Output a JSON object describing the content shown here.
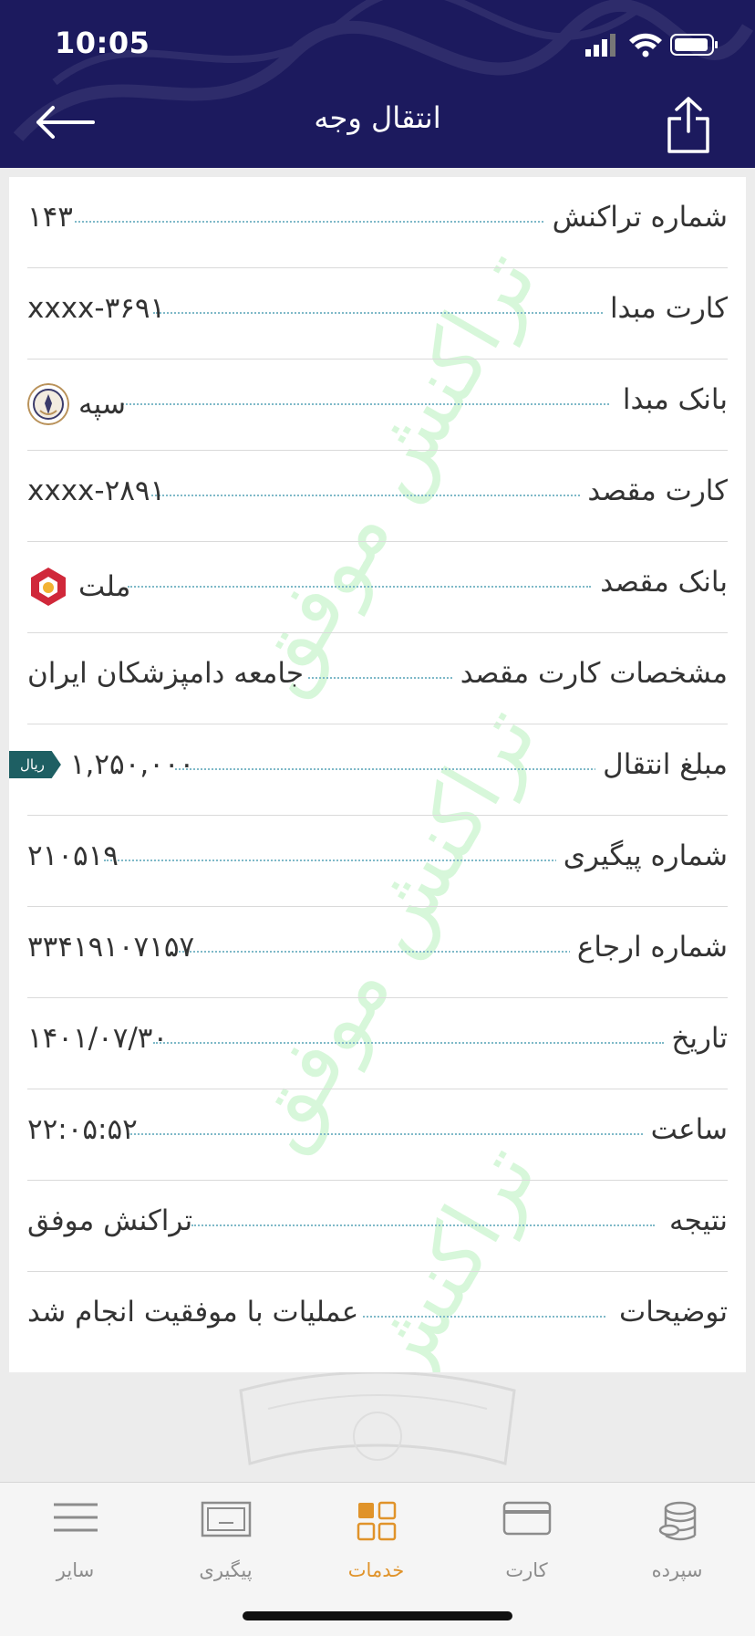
{
  "status_bar": {
    "time": "10:05"
  },
  "header": {
    "title": "انتقال وجه"
  },
  "watermark_text": "تراکنش موفق",
  "rows": [
    {
      "label": "شماره تراکنش",
      "value": "۱۴۳"
    },
    {
      "label": "کارت مبدا",
      "value": "xxxx-۳۶۹۱"
    },
    {
      "label": "بانک مبدا",
      "value": "سپه",
      "icon": "sepah-bank-logo-icon"
    },
    {
      "label": "کارت مقصد",
      "value": "xxxx-۲۸۹۱"
    },
    {
      "label": "بانک مقصد",
      "value": "ملت",
      "icon": "mellat-bank-logo-icon"
    },
    {
      "label": "مشخصات کارت مقصد",
      "value": "جامعه دامپزشکان ایران"
    },
    {
      "label": "مبلغ انتقال",
      "value": "۱,۲۵۰,۰۰۰",
      "badge": "ریال"
    },
    {
      "label": "شماره پیگیری",
      "value": "۲۱۰۵۱۹"
    },
    {
      "label": "شماره ارجاع",
      "value": "۳۳۴۱۹۱۰۷۱۵۷"
    },
    {
      "label": "تاریخ",
      "value": "۱۴۰۱/۰۷/۳۰"
    },
    {
      "label": "ساعت",
      "value": "۲۲:۰۵:۵۲"
    },
    {
      "label": "نتیجه",
      "value": "تراکنش موفق"
    },
    {
      "label": "توضیحات",
      "value": "عملیات با موفقیت انجام شد"
    }
  ],
  "tabs": [
    {
      "label": "سایر",
      "icon": "menu-lines-icon",
      "active": false
    },
    {
      "label": "پیگیری",
      "icon": "receipt-tray-icon",
      "active": false
    },
    {
      "label": "خدمات",
      "icon": "grid-services-icon",
      "active": true
    },
    {
      "label": "کارت",
      "icon": "credit-card-icon",
      "active": false
    },
    {
      "label": "سپرده",
      "icon": "coin-stack-icon",
      "active": false
    }
  ],
  "colors": {
    "header_bg": "#1c1a5e",
    "accent": "#e0932a",
    "badge_bg": "#1e5f63",
    "watermark": "#b8f2bd",
    "dots": "#7fb9c8"
  }
}
